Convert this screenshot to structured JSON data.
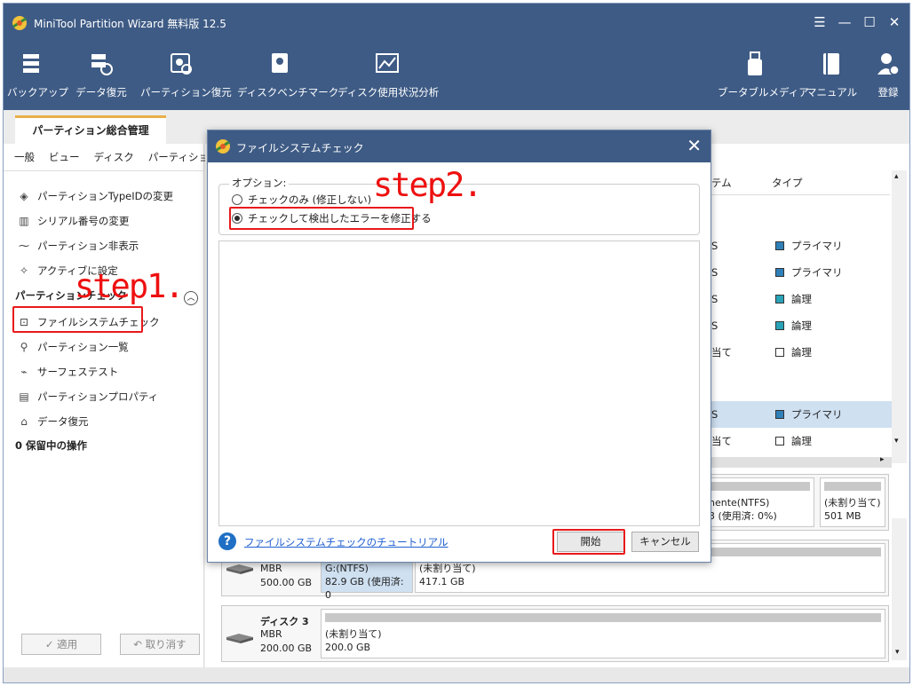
{
  "app": {
    "title": "MiniTool Partition Wizard 無料版 12.5"
  },
  "window_controls": {
    "menu": "☰",
    "minimize": "—",
    "maximize": "☐",
    "close": "✕"
  },
  "toolbar": {
    "backup": "バックアップ",
    "data_recovery": "データ復元",
    "partition_recovery": "パーティション復元",
    "disk_benchmark": "ディスクベンチマーク",
    "space_analyzer": "ディスク使用状況分析",
    "bootable_media": "ブータブルメディア",
    "manual": "マニュアル",
    "register": "登録"
  },
  "tabs": {
    "main": "パーティション総合管理"
  },
  "menu": {
    "general": "一般",
    "view": "ビュー",
    "disk": "ディスク",
    "partition": "パーティション"
  },
  "sidebar": {
    "items_top": [
      "パーティションTypeIDの変更",
      "シリアル番号の変更",
      "パーティション非表示",
      "アクティブに設定"
    ],
    "check_section": "パーティションチェック",
    "items_check": [
      "ファイルシステムチェック",
      "パーティション一覧",
      "サーフェステスト",
      "パーティションプロパティ",
      "データ復元"
    ],
    "pending": "0 保留中の操作",
    "apply": "✓ 適用",
    "undo": "↶ 取り消す"
  },
  "annotations": {
    "step1": "step1.",
    "step2": "step2."
  },
  "table": {
    "col_fs_partial": "テム",
    "col_type": "タイプ",
    "rows": [
      {
        "fs": "S",
        "type": "プライマリ",
        "color": "#2f7fb8"
      },
      {
        "fs": "S",
        "type": "プライマリ",
        "color": "#2f7fb8"
      },
      {
        "fs": "S",
        "type": "論理",
        "color": "#2aa3b8"
      },
      {
        "fs": "S",
        "type": "論理",
        "color": "#2aa3b8"
      },
      {
        "fs": "当て",
        "type": "論理",
        "color": "#ffffff"
      },
      {
        "fs": "S",
        "type": "プライマリ",
        "color": "#2f7fb8"
      },
      {
        "fs": "当て",
        "type": "論理",
        "color": "#ffffff"
      }
    ]
  },
  "disks": {
    "disk1": {
      "part_a": "nente(NTFS)",
      "part_a_usage": "3 (使用済: 0%)",
      "part_b": "(未割り当て)",
      "part_b_size": "501 MB"
    },
    "disk2": {
      "type": "MBR",
      "size": "500.00 GB",
      "part1_label": "G:(NTFS)",
      "part1_size": "82.9 GB (使用済: 0",
      "part2_label": "(未割り当て)",
      "part2_size": "417.1 GB"
    },
    "disk3": {
      "name": "ディスク 3",
      "type": "MBR",
      "size": "200.00 GB",
      "part_label": "(未割り当て)",
      "part_size": "200.0 GB"
    }
  },
  "dialog": {
    "title": "ファイルシステムチェック",
    "close": "✕",
    "options_label": "オプション:",
    "option_check_only": "チェックのみ (修正しない)",
    "option_check_fix": "チェックして検出したエラーを修正する",
    "help_icon": "?",
    "tutorial_link": "ファイルシステムチェックのチュートリアル",
    "start": "開始",
    "cancel": "キャンセル"
  },
  "colors": {
    "accent": "#3e5b85",
    "highlight": "#e8191b",
    "primary_partition": "#2f7fb8",
    "logical_partition": "#2aa3b8"
  }
}
